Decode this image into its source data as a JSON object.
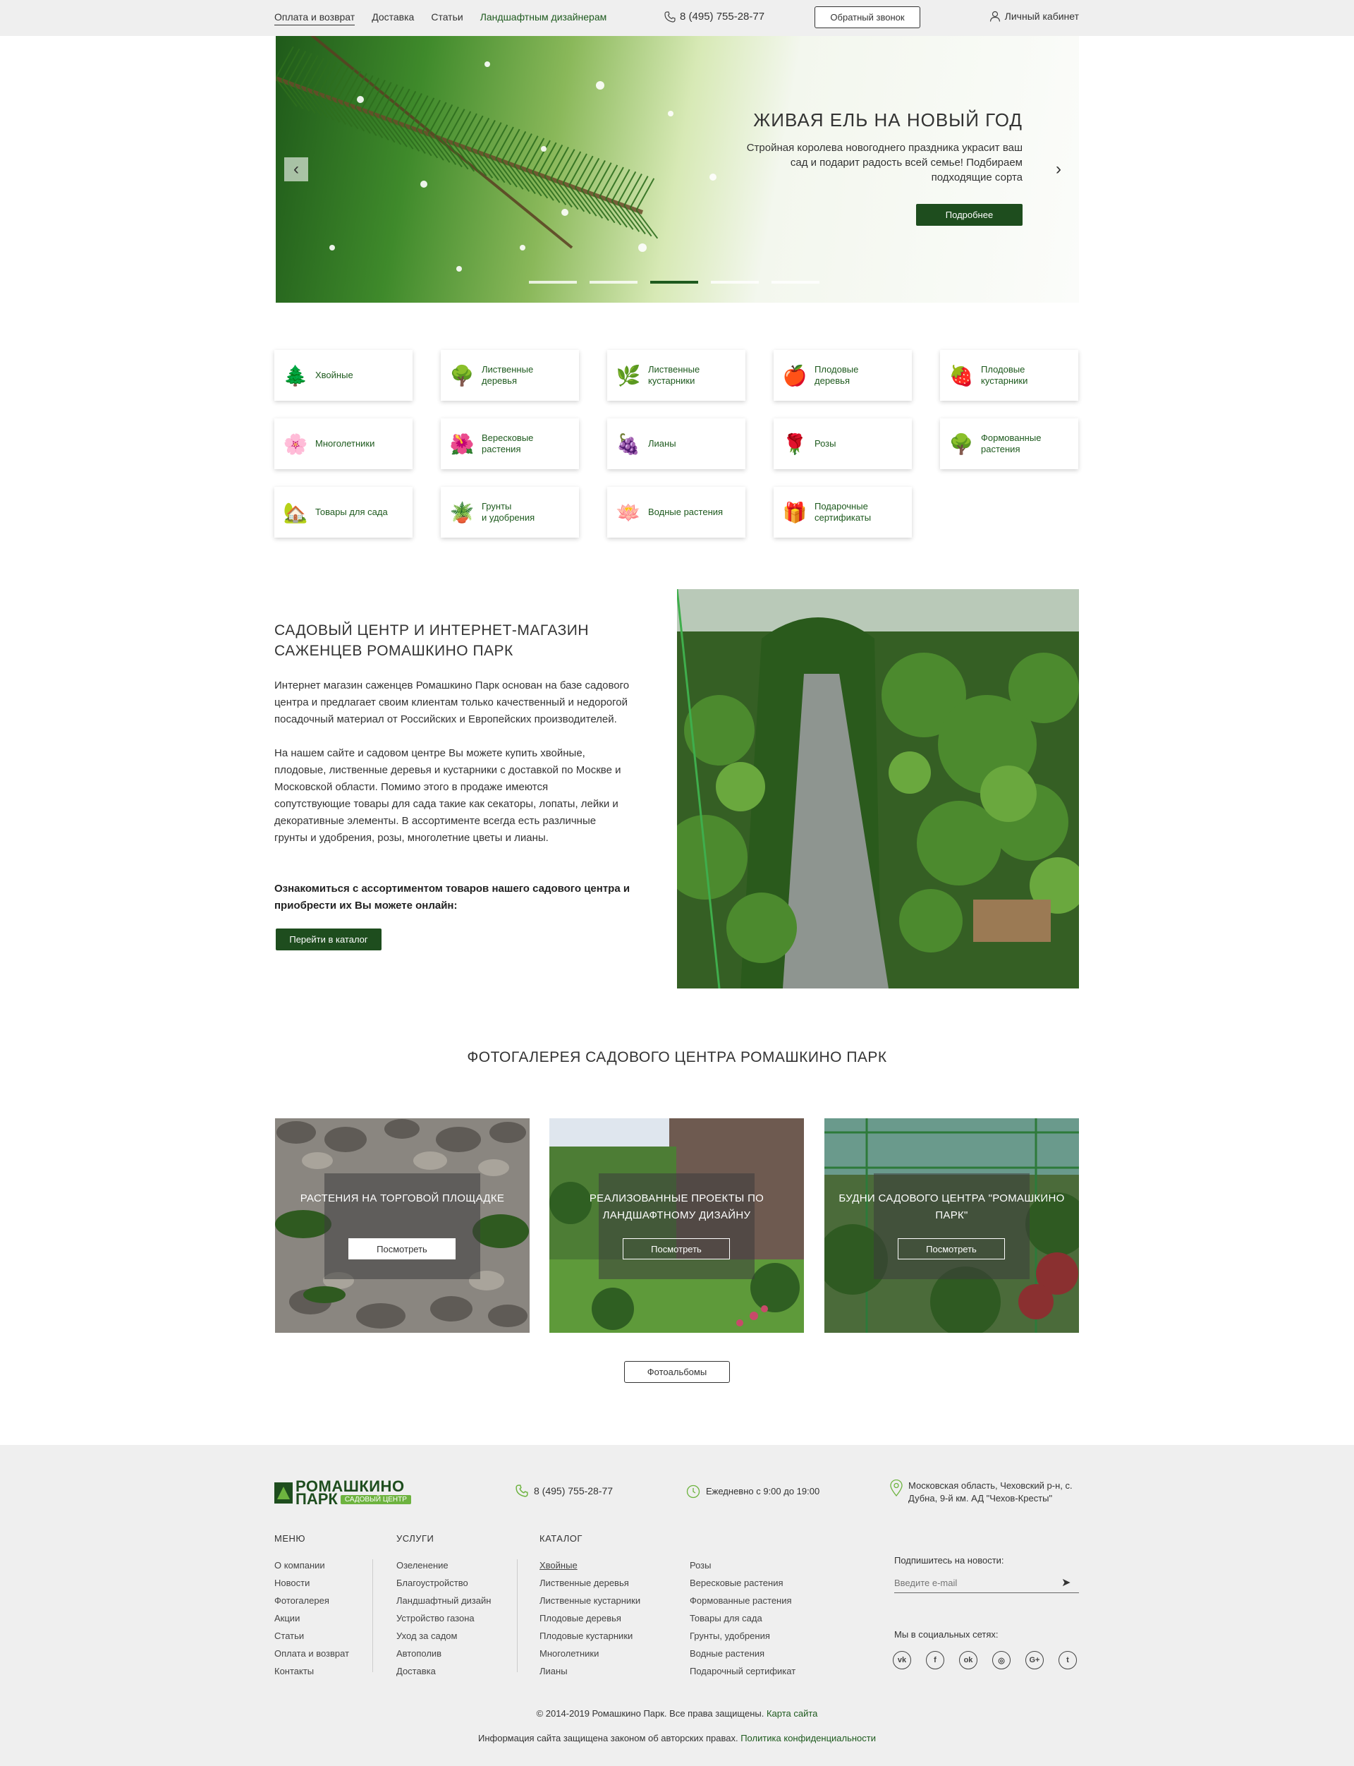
{
  "topbar": {
    "nav": [
      {
        "label": "Оплата и возврат",
        "style": "active"
      },
      {
        "label": "Доставка",
        "style": ""
      },
      {
        "label": "Статьи",
        "style": ""
      },
      {
        "label": "Ландшафтным дизайнерам",
        "style": "green"
      }
    ],
    "phone": "8 (495) 755-28-77",
    "callback": "Обратный звонок",
    "cabinet": "Личный кабинет"
  },
  "hero": {
    "title": "ЖИВАЯ ЕЛЬ НА НОВЫЙ ГОД",
    "text": "Стройная королева новогоднего праздника украсит ваш сад и подарит радость всей семье! Подбираем подходящие сорта",
    "button": "Подробнее",
    "slides": 5,
    "active_slide": 3
  },
  "categories": [
    {
      "label": "Хвойные",
      "icon": "conifer-icon",
      "glyph": "🌲"
    },
    {
      "label": "Лиственные\nдеревья",
      "icon": "deciduous-tree-icon",
      "glyph": "🌳"
    },
    {
      "label": "Лиственные\nкустарники",
      "icon": "shrub-icon",
      "glyph": "🌿"
    },
    {
      "label": "Плодовые\nдеревья",
      "icon": "fruit-tree-icon",
      "glyph": "🍎"
    },
    {
      "label": "Плодовые\nкустарники",
      "icon": "berry-icon",
      "glyph": "🍓"
    },
    {
      "label": "Многолетники",
      "icon": "perennial-icon",
      "glyph": "🌸"
    },
    {
      "label": "Вересковые\nрастения",
      "icon": "heather-icon",
      "glyph": "🌺"
    },
    {
      "label": "Лианы",
      "icon": "liana-icon",
      "glyph": "🍇"
    },
    {
      "label": "Розы",
      "icon": "rose-icon",
      "glyph": "🌹"
    },
    {
      "label": "Формованные\nрастения",
      "icon": "topiary-icon",
      "glyph": "🌳"
    },
    {
      "label": "Товары для сада",
      "icon": "garden-goods-icon",
      "glyph": "🏡"
    },
    {
      "label": "Грунты\nи удобрения",
      "icon": "soil-icon",
      "glyph": "🪴"
    },
    {
      "label": "Водные растения",
      "icon": "water-plant-icon",
      "glyph": "🪷"
    },
    {
      "label": "Подарочные\nсертификаты",
      "icon": "gift-card-icon",
      "glyph": "🎁"
    }
  ],
  "about": {
    "title": "САДОВЫЙ ЦЕНТР И ИНТЕРНЕТ-МАГАЗИН САЖЕНЦЕВ РОМАШКИНО ПАРК",
    "p1": "Интернет магазин саженцев Ромашкино Парк основан на базе садового центра и предлагает своим клиентам только качественный и недорогой посадочный материал от Российских и Европейских производителей.",
    "p2": "На нашем сайте и садовом центре Вы можете купить хвойные, плодовые, лиственные деревья и кустарники с доставкой по Москве и Московской области. Помимо этого в продаже имеются сопутствующие товары для сада такие как секаторы, лопаты, лейки и декоративные элементы. В ассортименте всегда есть различные грунты и удобрения, розы, многолетние цветы и лианы.",
    "p3": "Ознакомиться с ассортиментом товаров нашего садового центра и приобрести их Вы можете онлайн:",
    "button": "Перейти в каталог"
  },
  "gallery": {
    "title": "ФОТОГАЛЕРЕЯ САДОВОГО ЦЕНТРА РОМАШКИНО ПАРК",
    "items": [
      {
        "title": "РАСТЕНИЯ НА ТОРГОВОЙ ПЛОЩАДКЕ",
        "button": "Посмотреть"
      },
      {
        "title": "РЕАЛИЗОВАННЫЕ ПРОЕКТЫ ПО ЛАНДШАФТНОМУ ДИЗАЙНУ",
        "button": "Посмотреть"
      },
      {
        "title": "БУДНИ САДОВОГО ЦЕНТРА \"РОМАШКИНО ПАРК\"",
        "button": "Посмотреть"
      }
    ],
    "albums_button": "Фотоальбомы"
  },
  "footer": {
    "logo_line1": "РОМАШКИНО",
    "logo_line2": "ПАРК",
    "logo_tag": "САДОВЫЙ ЦЕНТР",
    "phone": "8 (495) 755-28-77",
    "hours": "Ежедневно с 9:00 до 19:00",
    "address": "Московская область, Чеховский р-н, с. Дубна, 9-й км. АД \"Чехов-Кресты\"",
    "menu": {
      "title": "МЕНЮ",
      "items": [
        "О компании",
        "Новости",
        "Фотогалерея",
        "Акции",
        "Статьи",
        "Оплата и возврат",
        "Контакты"
      ]
    },
    "services": {
      "title": "УСЛУГИ",
      "items": [
        "Озеленение",
        "Благоустройство",
        "Ландшафтный дизайн",
        "Устройство газона",
        "Уход за садом",
        "Автополив",
        "Доставка"
      ]
    },
    "catalog": {
      "title": "КАТАЛОГ",
      "col1": [
        "Хвойные",
        "Лиственные деревья",
        "Лиственные кустарники",
        "Плодовые деревья",
        "Плодовые кустарники",
        "Многолетники",
        "Лианы"
      ],
      "col2": [
        "Розы",
        "Вересковые растения",
        "Формованные растения",
        "Товары для сада",
        "Грунты, удобрения",
        "Водные растения",
        "Подарочный сертификат"
      ]
    },
    "subscribe_label": "Подпишитесь на новости:",
    "email_placeholder": "Введите e-mail",
    "social_label": "Мы в социальных сетях:",
    "socials": [
      {
        "name": "vk-icon",
        "glyph": "vk"
      },
      {
        "name": "facebook-icon",
        "glyph": "f"
      },
      {
        "name": "odnoklassniki-icon",
        "glyph": "ok"
      },
      {
        "name": "instagram-icon",
        "glyph": "◎"
      },
      {
        "name": "google-plus-icon",
        "glyph": "G+"
      },
      {
        "name": "twitter-icon",
        "glyph": "t"
      }
    ],
    "copyright": "© 2014-2019 Ромашкино Парк. Все права защищены.",
    "sitemap": "Карта сайта",
    "legal": "Информация сайта защищена законом об авторских правах.",
    "privacy": "Политика конфиденциальности"
  }
}
